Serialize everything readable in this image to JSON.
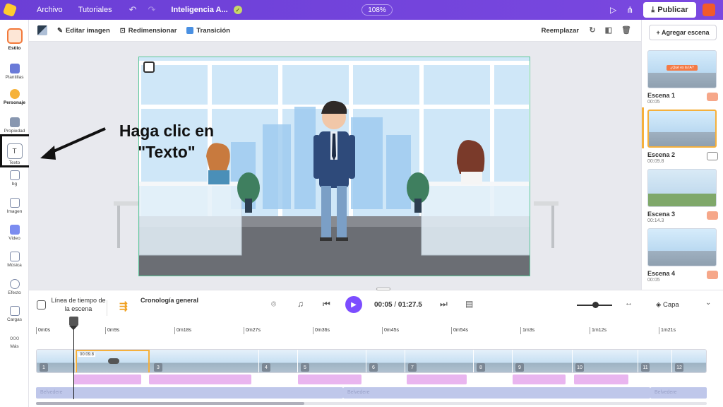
{
  "topbar": {
    "file_menu": "Archivo",
    "tutorials_menu": "Tutoriales",
    "project_title": "Inteligencia A...",
    "zoom": "108%",
    "publish_label": "Publicar"
  },
  "sidebar": {
    "items": [
      {
        "label": "Estilo"
      },
      {
        "label": "Plantillas"
      },
      {
        "label": "Personaje"
      },
      {
        "label": "Propiedad"
      },
      {
        "label": "Texto"
      },
      {
        "label": "bg"
      },
      {
        "label": "Imagen"
      },
      {
        "label": "Video"
      },
      {
        "label": "Música"
      },
      {
        "label": "Efecto"
      },
      {
        "label": "Cargas"
      },
      {
        "label": "Más"
      }
    ],
    "texto_glyph": "T",
    "more_glyph": "ooo"
  },
  "toolbar": {
    "edit_image": "Editar imagen",
    "resize": "Redimensionar",
    "transition": "Transición",
    "replace": "Reemplazar"
  },
  "annotation": {
    "text": "Haga clic en \"Texto\""
  },
  "scenes_panel": {
    "add_scene": "+ Agregar escena",
    "scene1_title": "¿Qué es la IA?",
    "scenes": [
      {
        "name": "Escena 1",
        "duration": "00:05"
      },
      {
        "name": "Escena 2",
        "duration": "00:09.8"
      },
      {
        "name": "Escena 3",
        "duration": "00:14.3"
      },
      {
        "name": "Escena 4",
        "duration": "00:05"
      }
    ]
  },
  "timeline": {
    "scene_timeline_label": "Línea de tiempo de la escena",
    "general_label": "Cronología general",
    "current_time": "00:05",
    "separator": "/",
    "total_time": "01:27.5",
    "layer_label": "Capa",
    "ruler": [
      "0m0s",
      "0m9s",
      "0m18s",
      "0m27s",
      "0m36s",
      "0m45s",
      "0m54s",
      "1m3s",
      "1m12s",
      "1m21s"
    ],
    "selected_duration": "00:09.8",
    "segments": [
      "1",
      "3",
      "4",
      "5",
      "6",
      "7",
      "8",
      "9",
      "10",
      "11",
      "12"
    ],
    "background_track_label": "Belvedere"
  },
  "colors": {
    "topbar": "#6b3fd6",
    "play_button": "#7c4dff",
    "selection": "#f5b03c",
    "canvas_border": "#5bc89b"
  }
}
